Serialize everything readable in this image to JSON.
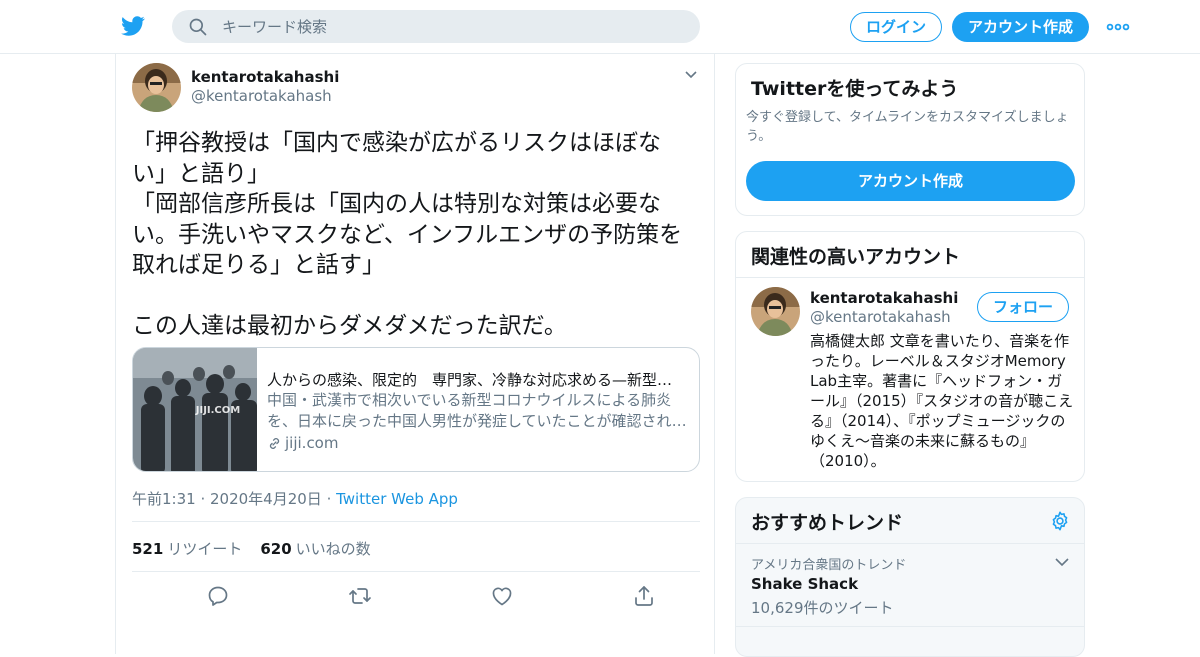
{
  "header": {
    "search_placeholder": "キーワード検索",
    "login_label": "ログイン",
    "signup_label": "アカウント作成"
  },
  "tweet": {
    "name": "kentarotakahashi",
    "handle": "@kentarotakahash",
    "text": "「押谷教授は「国内で感染が広がるリスクはほぼない」と語り」\n「岡部信彦所長は「国内の人は特別な対策は必要ない。手洗いやマスクなど、インフルエンザの予防策を取れば足りる」と話す」\n\nこの人達は最初からダメダメだった訳だ。",
    "card": {
      "image_label": "JIJI.COM",
      "title": "人からの感染、限定的　専門家、冷静な対応求める—新型コロナ：時事ドットコム",
      "desc_line1": "中国・武漢市で相次いでいる新型コロナウイルスによる肺炎",
      "desc_line2": "を、日本に戻った中国人男性が発症していたことが確認されました。",
      "domain": "jiji.com"
    },
    "timestamp": "午前1:31 · 2020年4月20日",
    "separator": " · ",
    "source": "Twitter Web App",
    "retweets": "521",
    "retweets_label": "リツイート",
    "likes": "620",
    "likes_label": "いいねの数"
  },
  "sidebar": {
    "try_title": "Twitterを使ってみよう",
    "try_sub": "今すぐ登録して、タイムラインをカスタマイズしましょう。",
    "try_button": "アカウント作成",
    "related_title": "関連性の高いアカウント",
    "related": {
      "name": "kentarotakahashi",
      "handle": "@kentarotakahash",
      "follow_label": "フォロー",
      "bio": "高橋健太郎 文章を書いたり、音楽を作ったり。レーベル＆スタジオMemory Lab主宰。著書に『ヘッドフォン・ガール』（2015）『スタジオの音が聴こえる』（2014）、『ポップミュージックのゆくえ〜音楽の未来に蘇るもの』（2010）。"
    },
    "trends_title": "おすすめトレンド",
    "trend": {
      "location": "アメリカ合衆国のトレンド",
      "name": "Shake Shack",
      "count": "10,629件のツイート"
    }
  },
  "colors": {
    "accent": "#1da1f2",
    "link": "#1b95e0",
    "secondary_text": "#657786",
    "border": "#e6ecf0"
  }
}
